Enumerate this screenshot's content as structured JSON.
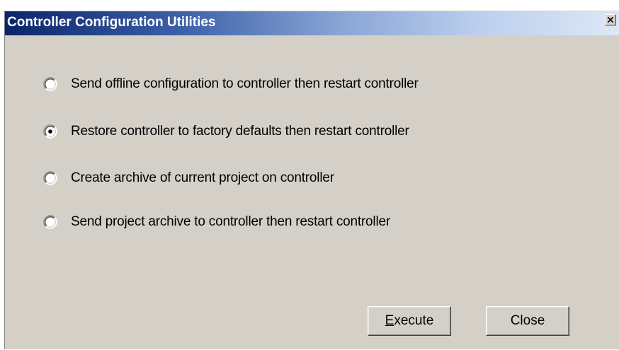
{
  "window": {
    "title": "Controller Configuration Utilities",
    "close_icon": "close-x-icon"
  },
  "options": [
    {
      "label": "Send offline configuration to controller then restart controller",
      "selected": false
    },
    {
      "label": "Restore controller to factory defaults then restart controller",
      "selected": true
    },
    {
      "label": "Create archive of current project on controller",
      "selected": false
    },
    {
      "label": "Send project archive to controller then restart controller",
      "selected": false
    }
  ],
  "buttons": {
    "execute": {
      "mnemonic": "E",
      "rest": "xecute"
    },
    "close": {
      "label": "Close"
    }
  },
  "colors": {
    "dialog_face": "#d4d0c8",
    "title_start": "#0a246a",
    "title_end": "#dde7f6"
  }
}
